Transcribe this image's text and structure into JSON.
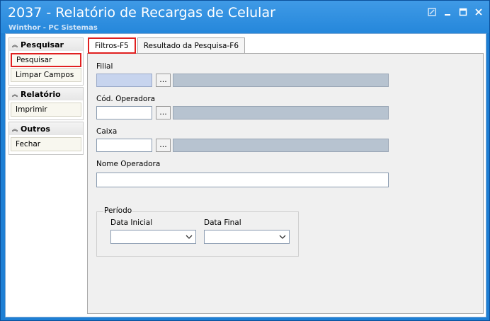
{
  "window": {
    "title": "2037 - Relatório de Recargas de Celular",
    "subtitle": "Winthor - PC Sistemas",
    "controls": [
      "restore-icon",
      "minimize-icon",
      "maximize-icon",
      "close-icon"
    ]
  },
  "sidebar": {
    "groups": [
      {
        "header": "Pesquisar",
        "items": [
          "Pesquisar",
          "Limpar Campos"
        ]
      },
      {
        "header": "Relatório",
        "items": [
          "Imprimir"
        ]
      },
      {
        "header": "Outros",
        "items": [
          "Fechar"
        ]
      }
    ]
  },
  "tabs": [
    {
      "label": "Filtros-F5",
      "active": true
    },
    {
      "label": "Resultado da Pesquisa-F6",
      "active": false
    }
  ],
  "form": {
    "filial_label": "Filial",
    "cod_operadora_label": "Cód. Operadora",
    "caixa_label": "Caixa",
    "nome_operadora_label": "Nome Operadora",
    "periodo_label": "Período",
    "data_inicial_label": "Data Inicial",
    "data_final_label": "Data Final",
    "lookup_button": "...",
    "filial_value": "",
    "cod_operadora_value": "",
    "caixa_value": "",
    "nome_operadora_value": "",
    "data_inicial_value": "",
    "data_final_value": ""
  },
  "colors": {
    "title_bar": "#2587db",
    "highlight": "#e02020",
    "disabled_field": "#b7c3d0",
    "focused_field": "#c7d4ee"
  }
}
